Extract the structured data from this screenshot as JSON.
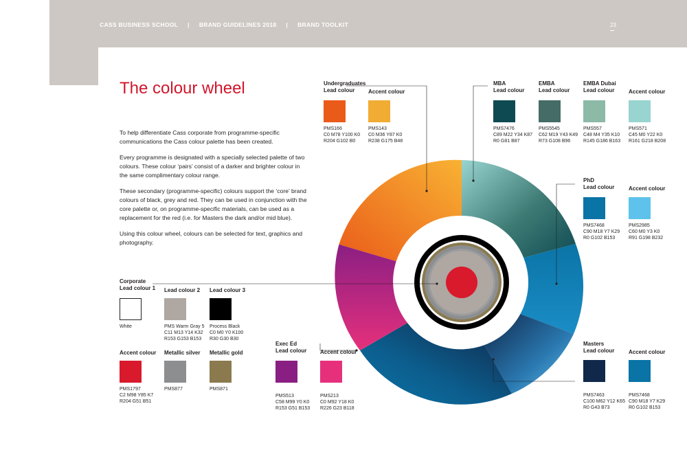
{
  "header": {
    "items": [
      "CASS BUSINESS SCHOOL",
      "BRAND GUIDELINES 2018",
      "BRAND TOOLKIT"
    ],
    "separator": "|",
    "page_number": "23"
  },
  "title": "The colour wheel",
  "paragraphs": [
    "To help differentiate Cass corporate from programme-specific communications the Cass colour palette has been created.",
    "Every programme is designated with a specially selected palette of two colours. These colour ‘pairs’ consist of a darker and brighter colour in the same complimentary colour range.",
    "These secondary (programme-specific) colours support the ‘core’ brand colours of black, grey and red. They can be used in conjunction with the core palette or, on programme-specific materials, can be used as a replacement for the red (i.e. for Masters the dark and/or mid blue).",
    "Using this colour wheel, colours can be selected for text, graphics and photography."
  ],
  "swatches": [
    {
      "id": "ug-lead",
      "label1": "Undergraduates",
      "label2": "Lead colour",
      "color": "#ea5b1a",
      "codes": [
        "PMS166",
        "C0 M78 Y100 K0",
        "R204 G102 B0"
      ]
    },
    {
      "id": "ug-accent",
      "label1": "",
      "label2": "Accent colour",
      "color": "#f1ac34",
      "codes": [
        "PMS143",
        "C0 M36 Y87 K0",
        "R238 G175 B48"
      ]
    },
    {
      "id": "mba-lead",
      "label1": "MBA",
      "label2": "Lead colour",
      "color": "#0e4a52",
      "codes": [
        "PMS7476",
        "C89 M22 Y34 K87",
        "R0 G81 B87"
      ]
    },
    {
      "id": "emba-lead",
      "label1": "EMBA",
      "label2": "Lead colour",
      "color": "#456c66",
      "codes": [
        "PMS5545",
        "C62 M19 Y43 K49",
        "R73 G108 B96"
      ]
    },
    {
      "id": "embad-lead",
      "label1": "EMBA Dubai",
      "label2": "Lead colour",
      "color": "#8cbaa7",
      "codes": [
        "PMS557",
        "C48 M4 Y35 K10",
        "R145 G186 B163"
      ]
    },
    {
      "id": "emba-accent",
      "label1": "",
      "label2": "Accent colour",
      "color": "#98d4d0",
      "codes": [
        "PMS571",
        "C45 M0 Y22 K0",
        "R161 G218 B208"
      ]
    },
    {
      "id": "phd-lead",
      "label1": "PhD",
      "label2": "Lead colour",
      "color": "#0a74a6",
      "codes": [
        "PMS7468",
        "C90 M18 Y7 K29",
        "R0 G102 B153"
      ]
    },
    {
      "id": "phd-accent",
      "label1": "",
      "label2": "Accent colour",
      "color": "#5fc2ec",
      "codes": [
        "PMS2985",
        "C60 M0 Y3 K0",
        "R91 G198 B232"
      ]
    },
    {
      "id": "masters-lead",
      "label1": "Masters",
      "label2": "Lead colour",
      "color": "#10284a",
      "codes": [
        "PMS7463",
        "C100 M62 Y12 K65",
        "R0 G43 B73"
      ]
    },
    {
      "id": "masters-accent",
      "label1": "",
      "label2": "Accent colour",
      "color": "#0a74a6",
      "codes": [
        "PMS7468",
        "C90 M18 Y7 K29",
        "R0 G102 B153"
      ]
    },
    {
      "id": "exec-lead",
      "label1": "Exec Ed",
      "label2": "Lead colour",
      "color": "#8a1f83",
      "codes": [
        "PMS513",
        "C58 M99 Y0 K0",
        "R153 G51 B153"
      ]
    },
    {
      "id": "exec-accent",
      "label1": "",
      "label2": "Accent colour",
      "color": "#e6307c",
      "codes": [
        "PMS213",
        "C0 M92 Y18 K0",
        "R226 G23 B118"
      ]
    },
    {
      "id": "corp-lead1",
      "label1": "Corporate",
      "label2": "Lead colour 1",
      "color": "#ffffff",
      "border": "#231f20",
      "codes": [
        "White"
      ]
    },
    {
      "id": "corp-lead2",
      "label1": "",
      "label2": "Lead colour 2",
      "color": "#aea7a2",
      "codes": [
        "PMS Warm Gray 5",
        "C11 M13 Y14 K32",
        "R153 G153 B153"
      ]
    },
    {
      "id": "corp-lead3",
      "label1": "",
      "label2": "Lead colour 3",
      "color": "#000000",
      "codes": [
        "Process Black",
        "C0 M0 Y0 K100",
        "R30 G30 B30"
      ]
    },
    {
      "id": "corp-accent",
      "label1": "",
      "label2": "Accent colour",
      "color": "#d9192c",
      "codes": [
        "PMS1797",
        "C2 M98 Y85 K7",
        "R204 G51 B51"
      ]
    },
    {
      "id": "corp-silver",
      "label1": "",
      "label2": "Metallic silver",
      "color": "#8c8e90",
      "codes": [
        "PMS877"
      ]
    },
    {
      "id": "corp-gold",
      "label1": "",
      "label2": "Metallic gold",
      "color": "#8a7a4e",
      "codes": [
        "PMS871"
      ]
    }
  ]
}
